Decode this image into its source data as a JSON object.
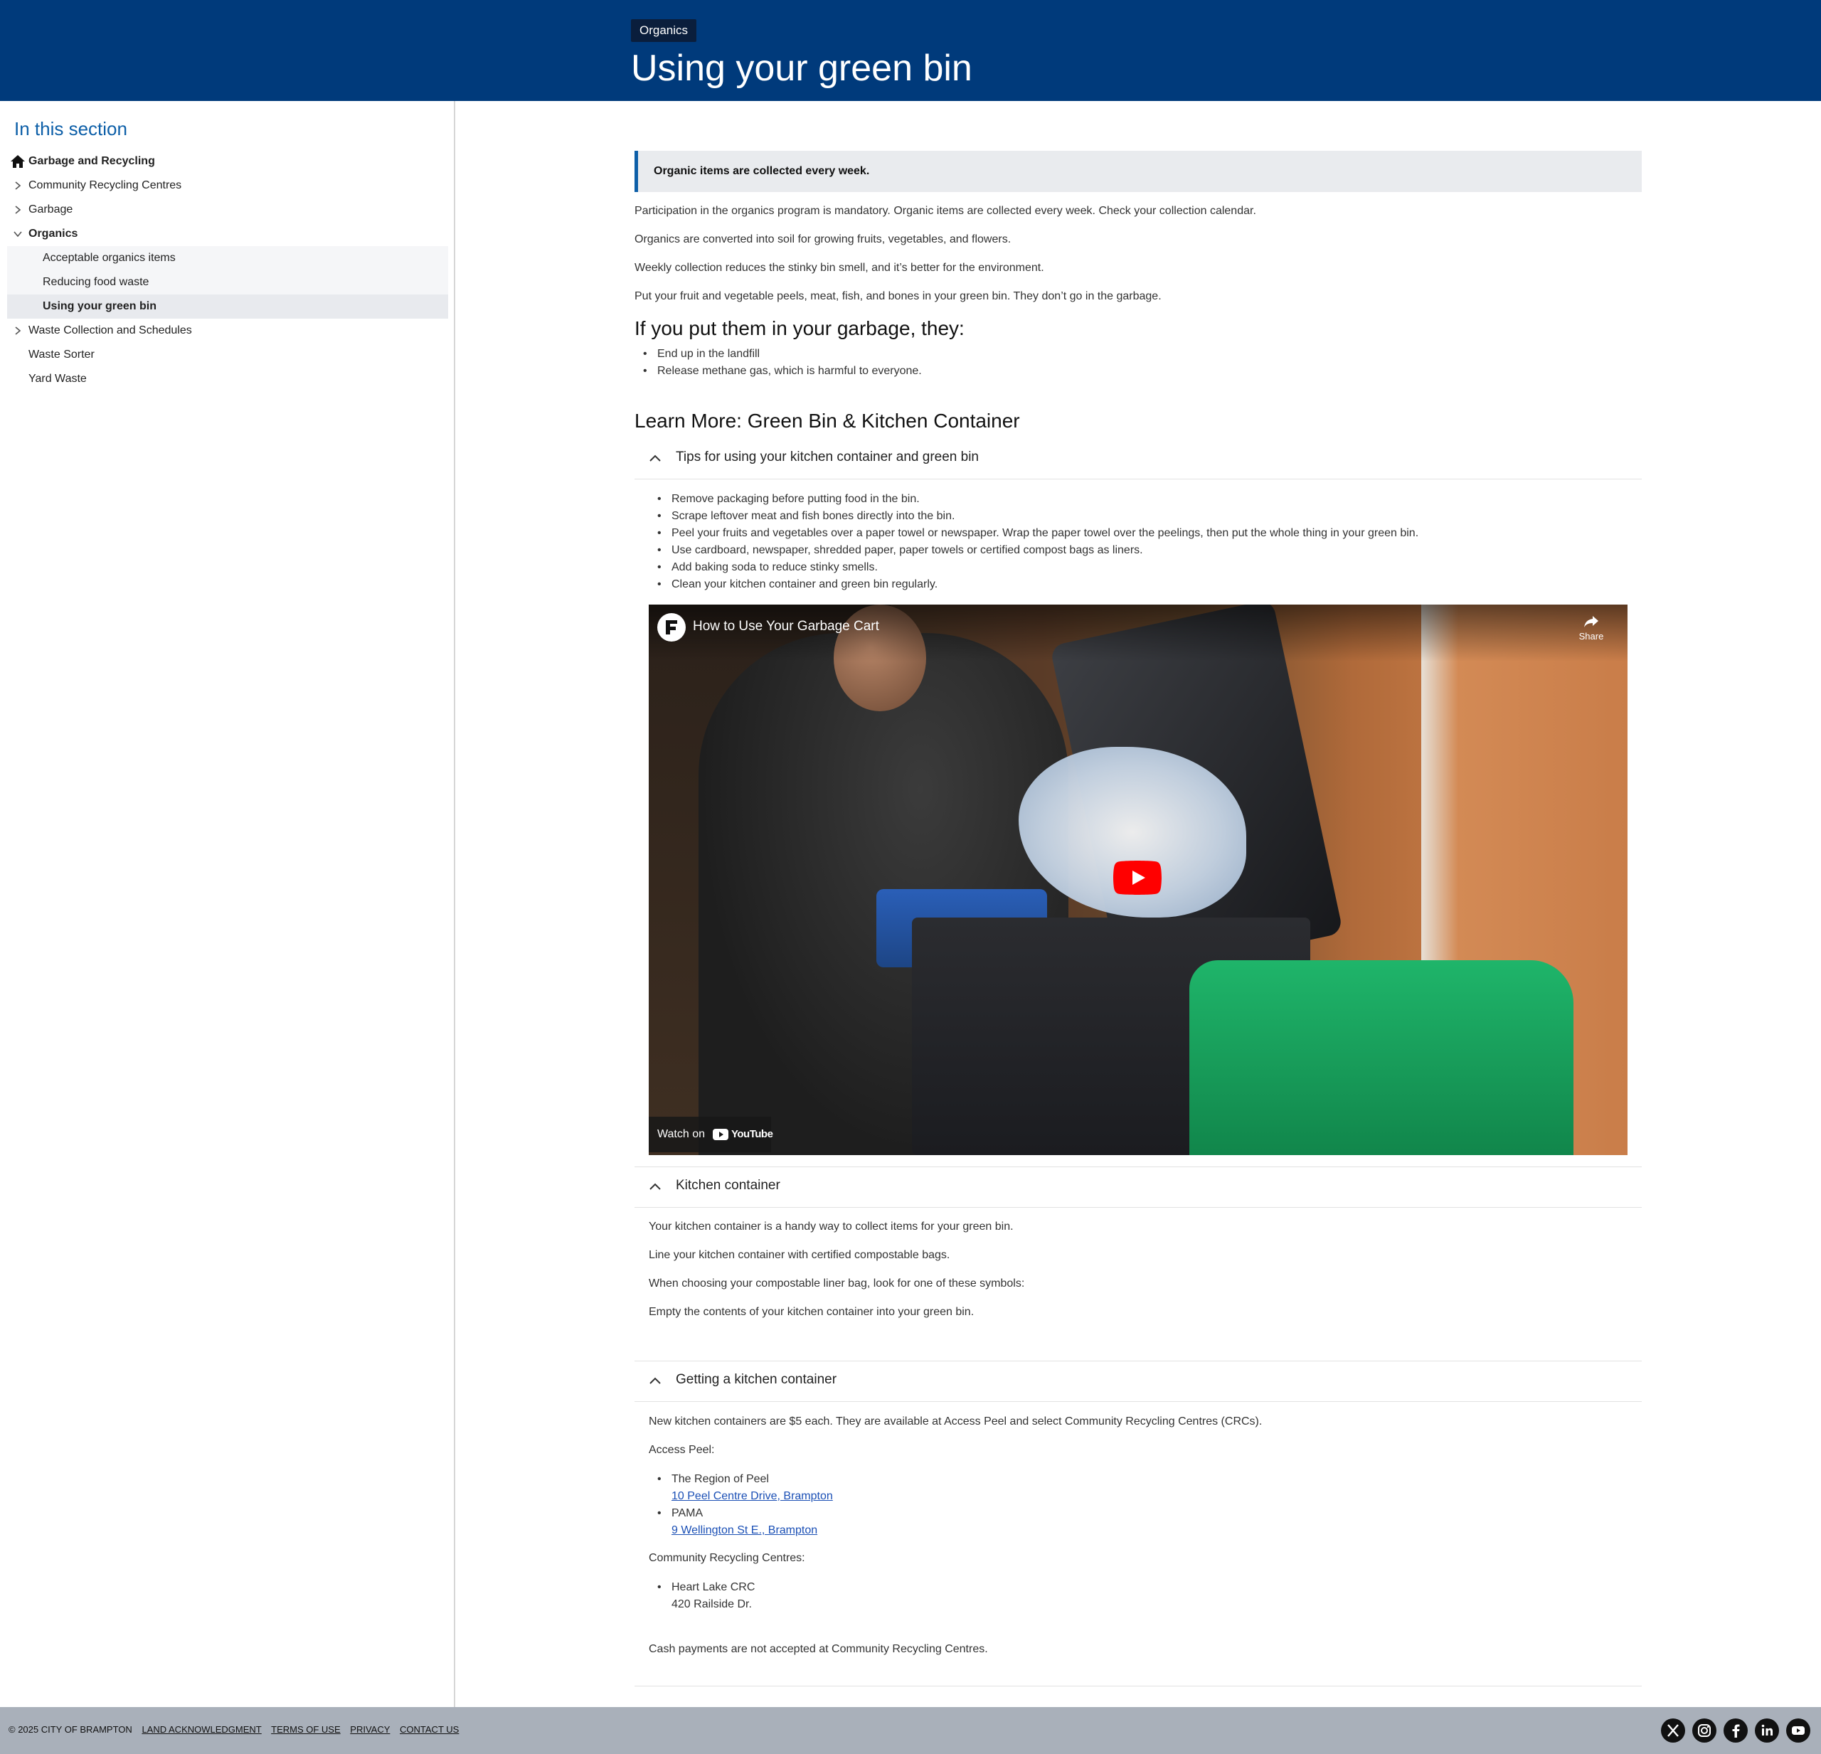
{
  "header": {
    "breadcrumb": "Organics",
    "title": "Using your green bin"
  },
  "sidebar": {
    "title": "In this section",
    "items": [
      {
        "label": "Garbage and Recycling"
      },
      {
        "label": "Community Recycling Centres"
      },
      {
        "label": "Garbage"
      },
      {
        "label": "Organics"
      },
      {
        "label": "Acceptable organics items"
      },
      {
        "label": "Reducing food waste"
      },
      {
        "label": "Using your green bin"
      },
      {
        "label": "Waste Collection and Schedules"
      },
      {
        "label": "Waste Sorter"
      },
      {
        "label": "Yard Waste"
      }
    ]
  },
  "main": {
    "callout": "Organic items are collected every week.",
    "intro": [
      "Participation in the organics program is mandatory. Organic items are collected every week. Check your collection calendar.",
      "Organics are converted into soil for growing fruits, vegetables, and flowers.",
      "Weekly collection reduces the stinky bin smell, and it’s better for the environment.",
      "Put your fruit and vegetable peels, meat, fish, and bones in your green bin. They don’t go in the garbage."
    ],
    "garbage_heading": "If you put them in your garbage, they:",
    "garbage_list": [
      "End up in the landfill",
      "Release methane gas, which is harmful to everyone."
    ],
    "learn_heading": "Learn More: Green Bin & Kitchen Container",
    "accordion1": {
      "title": "Tips for using your kitchen container and green bin",
      "tips": [
        "Remove packaging before putting food in the bin.",
        "Scrape leftover meat and fish bones directly into the bin.",
        "Peel your fruits and vegetables over a paper towel or newspaper. Wrap the paper towel over the peelings, then put the whole thing in your green bin.",
        "Use cardboard, newspaper, shredded paper, paper towels or certified compost bags as liners.",
        "Add baking soda to reduce stinky smells.",
        "Clean your kitchen container and green bin regularly."
      ]
    },
    "video": {
      "title": "How to Use Your Garbage Cart",
      "share": "Share",
      "watch_on": "Watch on",
      "youtube": "YouTube"
    },
    "accordion2": {
      "title": "Kitchen container",
      "paragraphs": [
        "Your kitchen container is a handy way to collect items for your green bin.",
        "Line your kitchen container with certified compostable bags.",
        "When choosing your compostable liner bag, look for one of these symbols:",
        "Empty the contents of your kitchen container into your green bin."
      ]
    },
    "accordion3": {
      "title": "Getting a kitchen container",
      "intro": "New kitchen containers are $5 each. They are available at Access Peel and select Community Recycling Centres (CRCs).",
      "access_label": "Access Peel:",
      "access": [
        {
          "name": "The Region of Peel",
          "address": "10 Peel Centre Drive, Brampton"
        },
        {
          "name": "PAMA",
          "address": "9 Wellington St E., Brampton"
        }
      ],
      "crc_label": "Community Recycling Centres:",
      "crc": [
        {
          "name": "Heart Lake CRC",
          "address": "420 Railside Dr."
        }
      ],
      "cash_note": "Cash payments are not accepted at Community Recycling Centres."
    }
  },
  "footer": {
    "copyright": "© 2025 CITY OF BRAMPTON",
    "links": [
      "LAND ACKNOWLEDGMENT",
      "TERMS OF USE",
      "PRIVACY",
      "CONTACT US"
    ],
    "social": [
      "x-icon",
      "instagram-icon",
      "facebook-icon",
      "linkedin-icon",
      "youtube-icon"
    ]
  },
  "colors": {
    "header_bg": "#003a7b",
    "accent": "#0d5fa8",
    "link": "#1a4fb5",
    "footer_bg": "#a9b0ba"
  }
}
